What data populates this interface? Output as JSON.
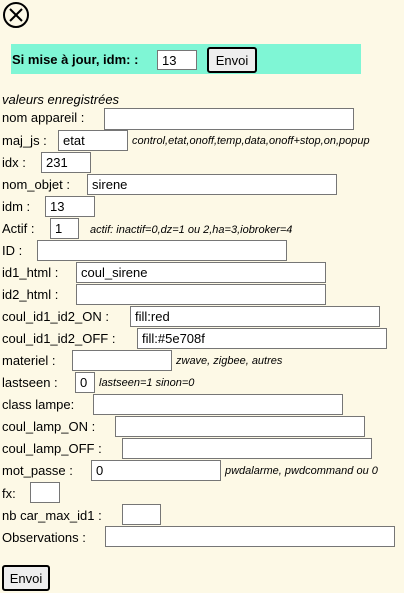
{
  "update": {
    "label": "Si mise à jour, idm: :",
    "idm_value": "13",
    "send_label": "Envoi"
  },
  "section_title": "valeurs enregistrées",
  "fields": {
    "nom_appareil": {
      "label": "nom appareil :",
      "value": ""
    },
    "maj_js": {
      "label": "maj_js :",
      "value": "etat",
      "hint": "control,etat,onoff,temp,data,onoff+stop,on,popup"
    },
    "idx": {
      "label": "idx :",
      "value": "231"
    },
    "nom_objet": {
      "label": "nom_objet :",
      "value": "sirene"
    },
    "idm": {
      "label": "idm :",
      "value": "13"
    },
    "actif": {
      "label": "Actif :",
      "value": "1",
      "hint": "actif: inactif=0,dz=1 ou 2,ha=3,iobroker=4"
    },
    "id": {
      "label": "ID :",
      "value": ""
    },
    "id1_html": {
      "label": "id1_html :",
      "value": "coul_sirene"
    },
    "id2_html": {
      "label": "id2_html :",
      "value": ""
    },
    "coul_on": {
      "label": "coul_id1_id2_ON :",
      "value": "fill:red"
    },
    "coul_off": {
      "label": "coul_id1_id2_OFF :",
      "value": "fill:#5e708f"
    },
    "materiel": {
      "label": "materiel :",
      "value": "",
      "hint": "zwave, zigbee, autres"
    },
    "lastseen": {
      "label": "lastseen :",
      "value": "0",
      "hint": "lastseen=1 sinon=0"
    },
    "class_lampe": {
      "label": "class lampe:",
      "value": ""
    },
    "coul_lamp_on": {
      "label": "coul_lamp_ON :",
      "value": ""
    },
    "coul_lamp_off": {
      "label": "coul_lamp_OFF :",
      "value": ""
    },
    "mot_passe": {
      "label": "mot_passe :",
      "value": "0",
      "hint": "pwdalarme, pwdcommand ou 0"
    },
    "fx": {
      "label": "fx:",
      "value": ""
    },
    "nb_car_max": {
      "label": "nb car_max_id1 :",
      "value": ""
    },
    "observations": {
      "label": "Observations :",
      "value": ""
    }
  },
  "submit_label": "Envoi"
}
